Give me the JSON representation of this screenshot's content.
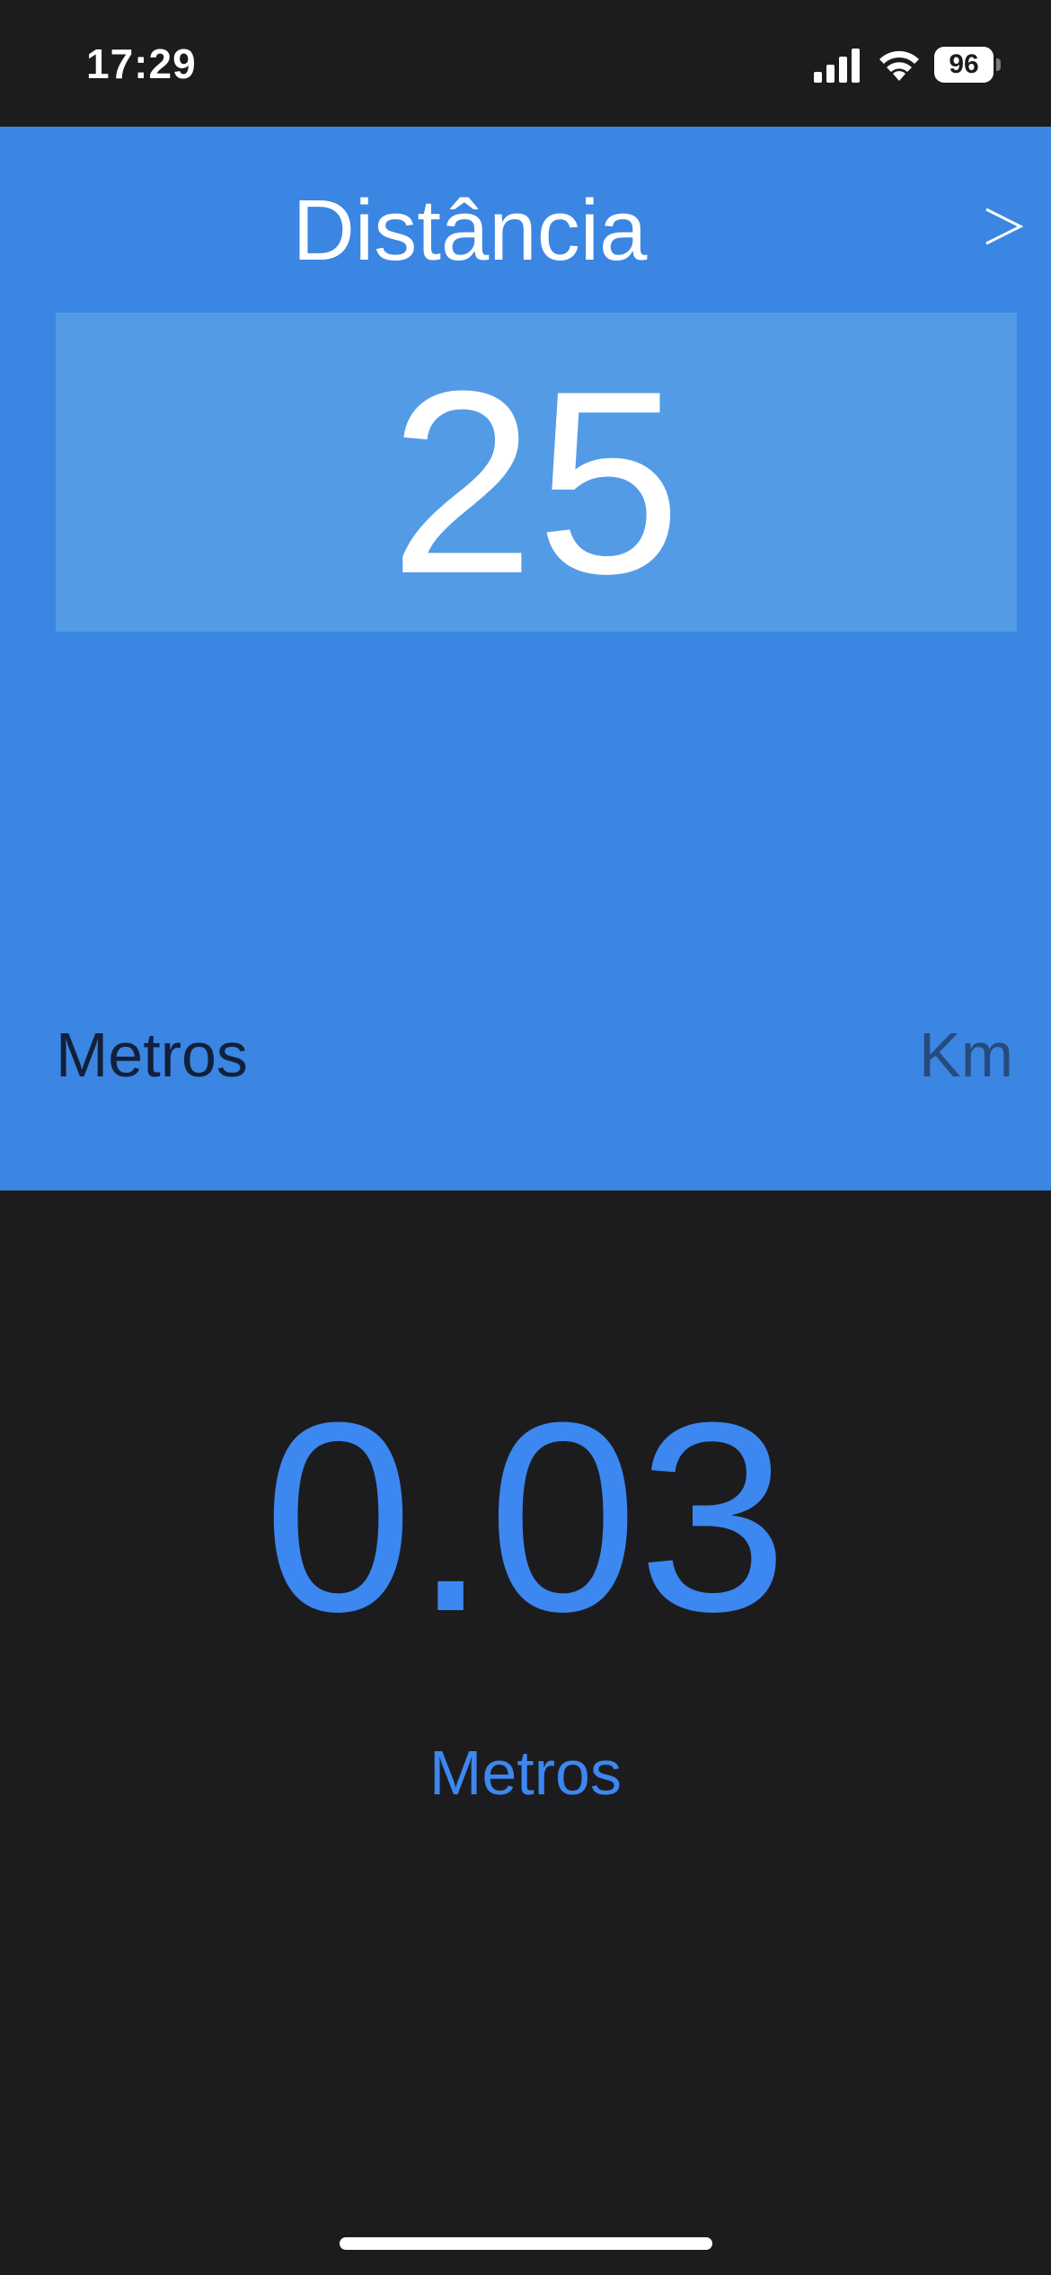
{
  "status_bar": {
    "time": "17:29",
    "battery_level": "96",
    "icons": [
      "signal-icon",
      "wifi-icon",
      "battery-icon"
    ]
  },
  "converter": {
    "title": "Distância",
    "next_icon": "chevron-right-icon",
    "input_value": "25",
    "from_unit": "Metros",
    "to_unit": "Km"
  },
  "result": {
    "value": "0.03",
    "unit": "Metros"
  },
  "colors": {
    "panel_bg": "#3a86e2",
    "input_box_bg": "#549be6",
    "accent": "#3d87f0",
    "app_bg": "#1c1c1e"
  }
}
